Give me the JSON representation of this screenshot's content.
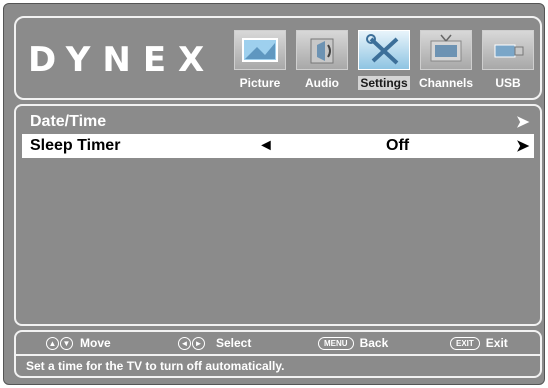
{
  "brand": {
    "logo_text": "DYNEX"
  },
  "tabs": [
    {
      "label": "Picture",
      "icon": "picture-icon",
      "active": false
    },
    {
      "label": "Audio",
      "icon": "audio-icon",
      "active": false
    },
    {
      "label": "Settings",
      "icon": "settings-icon",
      "active": true
    },
    {
      "label": "Channels",
      "icon": "channels-icon",
      "active": false
    },
    {
      "label": "USB",
      "icon": "usb-icon",
      "active": false
    }
  ],
  "menu": {
    "items": [
      {
        "label": "Date/Time",
        "right_arrow": "➤"
      },
      {
        "label": "Sleep Timer",
        "left_arrow": "◄",
        "value": "Off",
        "right_arrow": "➤"
      }
    ],
    "selected_index": 1
  },
  "legend": {
    "move": {
      "keys": [
        "▲",
        "▼"
      ],
      "label": "Move"
    },
    "select": {
      "keys": [
        "◄",
        "►"
      ],
      "label": "Select"
    },
    "back": {
      "key": "MENU",
      "label": "Back"
    },
    "exit": {
      "key": "EXIT",
      "label": "Exit"
    }
  },
  "help_text": "Set a time for the TV to turn off automatically.",
  "colors": {
    "background": "#8b8b8b",
    "border": "#f2f2f2",
    "selected_row": "#ffffff",
    "active_tab_icon": "#8ec4e2"
  }
}
